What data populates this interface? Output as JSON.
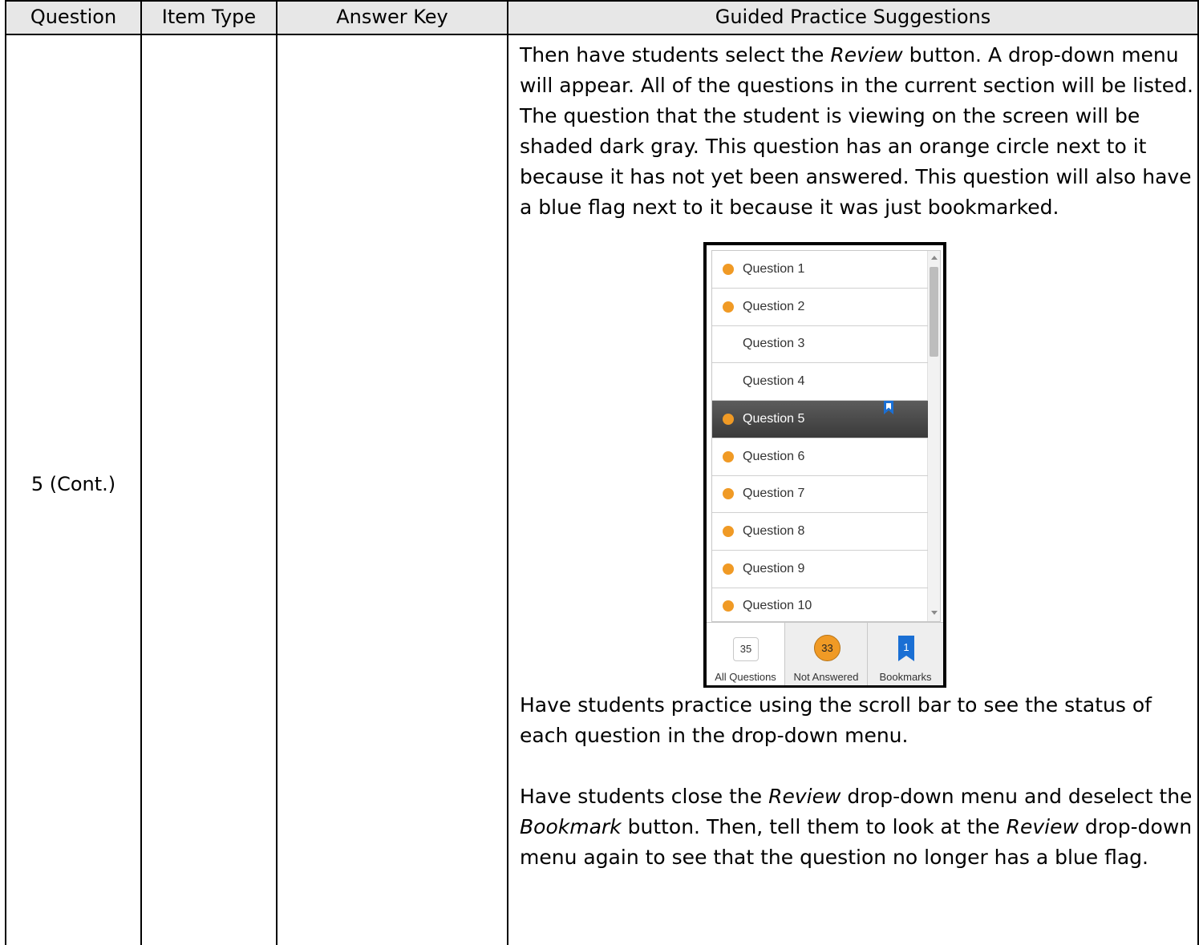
{
  "headers": [
    "Question",
    "Item Type",
    "Answer Key",
    "Guided Practice Suggestions"
  ],
  "row": {
    "question": "5 (Cont.)",
    "item_type": "",
    "answer_key": ""
  },
  "paragraph1": {
    "p1": "Then have students select the ",
    "p1_em": "Review",
    "p1_rest": " button.   A drop-down menu will appear.  All of the questions in the current section will be listed.  The question that the student is viewing on the screen will be shaded dark gray.  This question has an orange circle next to it because it has not yet been answered.  This question will also have a blue flag next to it because it was just bookmarked."
  },
  "review_menu": {
    "items": [
      {
        "label": "Question 1",
        "status": "not-answered"
      },
      {
        "label": "Question 2",
        "status": "not-answered"
      },
      {
        "label": "Question 3",
        "status": "answered"
      },
      {
        "label": "Question 4",
        "status": "answered"
      },
      {
        "label": "Question 5",
        "status": "not-answered-current-bookmarked"
      },
      {
        "label": "Question 6",
        "status": "not-answered"
      },
      {
        "label": "Question 7",
        "status": "not-answered"
      },
      {
        "label": "Question 8",
        "status": "not-answered"
      },
      {
        "label": "Question 9",
        "status": "not-answered"
      },
      {
        "label": "Question 10",
        "status": "not-answered"
      }
    ],
    "tabs": {
      "all": {
        "count": "35",
        "label": "All Questions"
      },
      "not_answered": {
        "count": "33",
        "label": "Not Answered"
      },
      "bookmarks": {
        "count": "1",
        "label": "Bookmarks"
      }
    },
    "colors": {
      "not_answered_dot": "#f09a25",
      "bookmark_blue": "#1a6fd4",
      "current_row": "#4a4a4a"
    }
  },
  "paragraph2": "Have students practice using the scroll bar to see the status of each question in the drop-down menu.",
  "paragraph3": {
    "a": "Have students close the ",
    "a_em": "Review",
    "b": " drop-down menu and deselect the ",
    "b_em": "Bookmark",
    "c": " button. Then, tell them to look at the ",
    "c_em": "Review",
    "d": " drop-down menu again to see that the question no longer has a blue flag."
  }
}
